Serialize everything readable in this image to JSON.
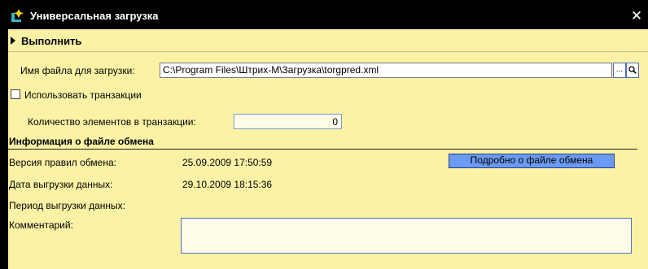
{
  "window": {
    "title": "Универсальная загрузка",
    "close_glyph": "✕",
    "accent": "#fbf2a5"
  },
  "toolbar": {
    "run_label": "Выполнить"
  },
  "file": {
    "label": "Имя файла для загрузки:",
    "value": "C:\\Program Files\\Штрих-М\\Загрузка\\torgpred.xml",
    "browse_label": "...",
    "open_icon": "search-icon"
  },
  "transactions": {
    "checkbox_label": "Использовать транзакции",
    "checked": false,
    "count_label": "Количество элементов в транзакции:",
    "count_value": "0"
  },
  "info": {
    "section_title": "Информация о файле обмена",
    "rules_version_label": "Версия правил обмена:",
    "rules_version_value": "25.09.2009 17:50:59",
    "details_button": "Подробно о файле обмена",
    "export_date_label": "Дата выгрузки данных:",
    "export_date_value": "29.10.2009 18:15:36",
    "export_period_label": "Период выгрузки данных:",
    "comment_label": "Комментарий:",
    "comment_value": ""
  }
}
